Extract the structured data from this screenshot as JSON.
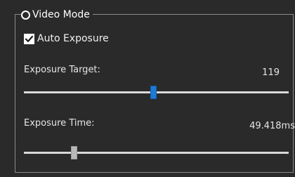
{
  "group": {
    "title": "Video Mode"
  },
  "auto_exposure": {
    "label": "Auto Exposure",
    "checked": true
  },
  "exposure_target": {
    "label": "Exposure Target:",
    "value": "119",
    "slider_fraction": 0.49
  },
  "exposure_time": {
    "label": "Exposure Time:",
    "value": "49.418ms",
    "slider_fraction": 0.19
  },
  "colors": {
    "accent": "#1e7ad6",
    "background": "#2a2a2a",
    "text": "#e6e6e6"
  },
  "icons": {
    "mode_radio": "radio-button-icon",
    "auto_exposure_check": "checkmark-icon"
  }
}
